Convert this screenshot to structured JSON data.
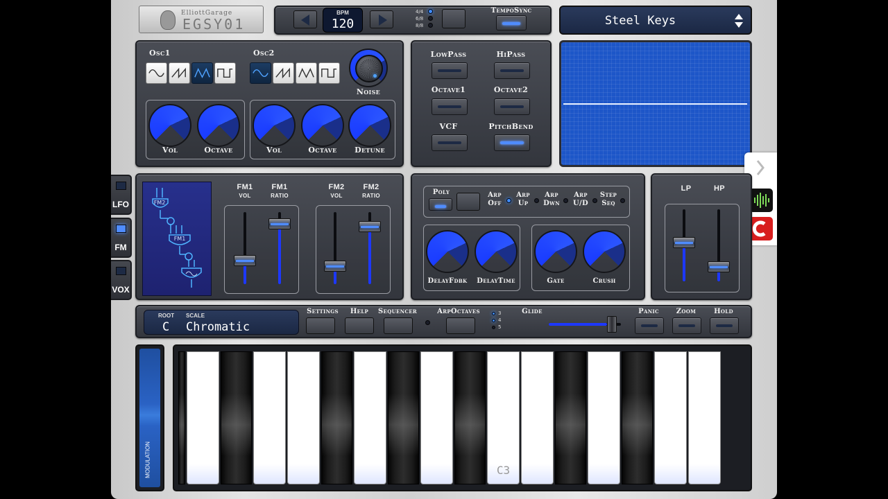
{
  "logo": {
    "brand": "ElliottGarage",
    "model": "EGSY01"
  },
  "transport": {
    "bpm_label": "BPM",
    "bpm_value": "120",
    "time_sigs": [
      "4/4",
      "6/8",
      "8/8"
    ],
    "tempo_sync_label": "TempoSync"
  },
  "preset": {
    "name": "Steel Keys"
  },
  "osc": {
    "osc1_label": "Osc1",
    "osc2_label": "Osc2",
    "noise_label": "Noise",
    "osc1_knobs": [
      "Vol",
      "Octave"
    ],
    "osc2_knobs": [
      "Vol",
      "Octave",
      "Detune"
    ]
  },
  "filters": {
    "lowpass": "LowPass",
    "hipass": "HiPass",
    "octave1": "Octave1",
    "octave2": "Octave2",
    "vcf": "VCF",
    "pitchbend": "PitchBend"
  },
  "side_tabs": [
    "LFO",
    "FM",
    "VOX"
  ],
  "fm": {
    "fm1_vol": [
      "FM1",
      "VOL"
    ],
    "fm1_ratio": [
      "FM1",
      "RATIO"
    ],
    "fm2_vol": [
      "FM2",
      "VOL"
    ],
    "fm2_ratio": [
      "FM2",
      "RATIO"
    ],
    "diagram_fm2": "FM2",
    "diagram_fm1": "FM1",
    "levels": {
      "fm1_vol": 0.3,
      "fm1_ratio": 0.9,
      "fm2_vol": 0.2,
      "fm2_ratio": 0.85
    }
  },
  "arp": {
    "poly": "Poly",
    "arp_off": [
      "Arp",
      "Off"
    ],
    "arp_up": [
      "Arp",
      "Up"
    ],
    "arp_dwn": [
      "Arp",
      "Dwn"
    ],
    "arp_ud": [
      "Arp",
      "U/D"
    ],
    "step_seq": [
      "Step",
      "Seq"
    ],
    "knobs": [
      "DelayFdbk",
      "DelayTime",
      "Gate",
      "Crush"
    ]
  },
  "eq": {
    "lp": "LP",
    "hp": "HP",
    "levels": {
      "lp": 0.55,
      "hp": 0.15
    }
  },
  "bottom_bar": {
    "root_label": "ROOT",
    "root_value": "C",
    "scale_label": "SCALE",
    "scale_value": "Chromatic",
    "settings": "Settings",
    "help": "Help",
    "sequencer": "Sequencer",
    "arp_octaves": "ArpOctaves",
    "octave_options": [
      "3",
      "4",
      "5"
    ],
    "glide": "Glide",
    "panic": "Panic",
    "zoom": "Zoom",
    "hold": "Hold"
  },
  "keyboard": {
    "modulation_label": "MODULATION",
    "c3_label": "C3"
  },
  "colors": {
    "accent": "#3f8cff",
    "panel": "#3a3d44",
    "scope": "#1d56c8"
  }
}
